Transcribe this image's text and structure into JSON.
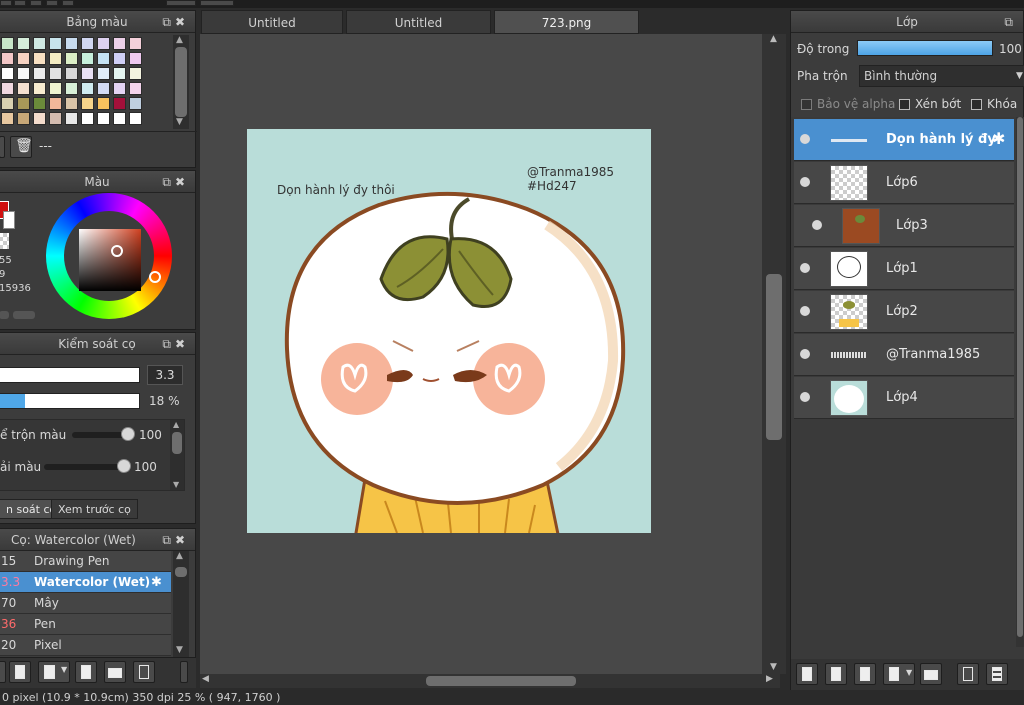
{
  "palette": {
    "title": "Bảng màu",
    "none_label": "---",
    "swatches": [
      [
        "#c8e6c9",
        "#d4ecd9",
        "#cfe8e2",
        "#c8e4ec",
        "#c8dcef",
        "#d0d6f0",
        "#dcd0ee",
        "#ecd0e8",
        "#f4d0da"
      ],
      [
        "#f3c7c7",
        "#f6d2c2",
        "#f8e0c2",
        "#f4ecc2",
        "#dcefc6",
        "#c6efdc",
        "#c4e2f3",
        "#cfcff6",
        "#efc9ef"
      ],
      [
        "#ffffff",
        "#f6f6f6",
        "#ececec",
        "#e2e2e2",
        "#d8d8d8",
        "#e8e0f4",
        "#e0ecf8",
        "#e4f4f0",
        "#f4f4e0"
      ],
      [
        "#f0d8e0",
        "#f4e0d0",
        "#f8ecd0",
        "#f0f4d0",
        "#d8f0d8",
        "#d0ecf0",
        "#d4dcf4",
        "#e4d4f4",
        "#f4d4ec"
      ],
      [
        "#d8d0b0",
        "#a89858",
        "#6b8a3a",
        "#f2b89a",
        "#d9c4a8",
        "#f6d48a",
        "#f7c15e",
        "#a3103a",
        "#bfcfe0"
      ],
      [
        "#e8c8a0",
        "#c8a878",
        "#f4dccc",
        "#d4bcb0",
        "#e8e8e8",
        "#ffffff",
        "#ffffff",
        "#ffffff",
        "#ffffff"
      ]
    ]
  },
  "color": {
    "title": "Màu",
    "readout_a": "55",
    "readout_b": "9",
    "readout_c": "15936"
  },
  "brush_control": {
    "title": "Kiểm soát cọ",
    "size_value": "3.3",
    "opacity_value": "18 %",
    "opacity_fill": 0.18,
    "mix_label": "ể trộn màu",
    "mix_value": "100",
    "mix_level": 1.0,
    "dilute_label": "ải màu",
    "dilute_value": "100",
    "dilute_level": 1.0,
    "tab1": "n soát cọ",
    "tab2": "Xem trước cọ"
  },
  "brush_list": {
    "title": "Cọ: Watercolor (Wet)",
    "items": [
      {
        "size": "15",
        "name": "Drawing Pen",
        "selected": false,
        "size_color": "#ffffff"
      },
      {
        "size": "3.3",
        "name": "Watercolor (Wet)",
        "selected": true,
        "size_color": "#ff6b8a"
      },
      {
        "size": "70",
        "name": "Mây",
        "selected": false,
        "size_color": "#ffffff"
      },
      {
        "size": "36",
        "name": "Pen",
        "selected": false,
        "size_color": "#ff6b6b"
      },
      {
        "size": "20",
        "name": "Pixel",
        "selected": false,
        "size_color": "#ffffff"
      }
    ]
  },
  "tabs": [
    "Untitled",
    "Untitled",
    "723.png"
  ],
  "artwork": {
    "caption": "Dọn hành lý đy thôi",
    "credit1": "@Tranma1985",
    "credit2": "#Hd247"
  },
  "layers": {
    "title": "Lớp",
    "opacity_label": "Độ trong",
    "opacity_value": "100 %",
    "opacity_fill": 1.0,
    "blend_label": "Pha trộn",
    "blend_value": "Bình thường",
    "protect_alpha": "Bảo vệ alpha",
    "clip": "Xén bớt",
    "lock": "Khóa",
    "items": [
      {
        "name": "Dọn hành lý đy",
        "selected": true,
        "thumb": "text"
      },
      {
        "name": "Lớp6",
        "selected": false,
        "thumb": "checker"
      },
      {
        "name": "Lớp3",
        "selected": false,
        "thumb": "brown"
      },
      {
        "name": "Lớp1",
        "selected": false,
        "thumb": "sketch"
      },
      {
        "name": "Lớp2",
        "selected": false,
        "thumb": "color"
      },
      {
        "name": "@Tranma1985",
        "selected": false,
        "thumb": "text"
      },
      {
        "name": "Lớp4",
        "selected": false,
        "thumb": "base"
      }
    ]
  },
  "status": {
    "text": "0 pixel  (10.9 * 10.9cm)  350 dpi  25 %  ( 947, 1760 )"
  }
}
